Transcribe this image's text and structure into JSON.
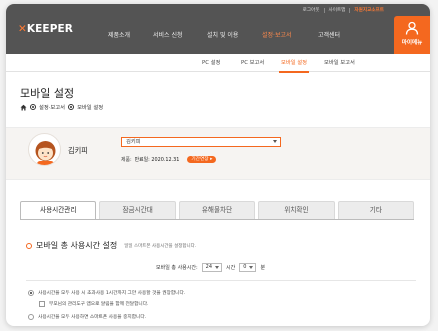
{
  "header": {
    "util_links": [
      "로그아웃",
      "사이트맵"
    ],
    "brand_link": "자원지교소프트",
    "logo_mark": "✕",
    "logo_text": "KEEPER",
    "nav": [
      "제품소개",
      "서비스 신청",
      "설치 및 이용",
      "설정·보고서",
      "고객센터"
    ],
    "active_nav": "설정·보고서",
    "my_menu_label": "마이메뉴",
    "accent_color": "#f4681f"
  },
  "subnav": {
    "items": [
      "PC 설정",
      "PC 보고서",
      "모바일 설정",
      "모바일 보고서"
    ],
    "active": "모바일 설정"
  },
  "page": {
    "title": "모바일 설정",
    "breadcrumb": [
      "설정·보고서",
      "모바일 설정"
    ]
  },
  "profile": {
    "name": "김키피",
    "selected_child": "김키피",
    "expiry_label": "제품:",
    "expiry_value": "만료일: 2020.12.31",
    "extend_button": "기간연장 ▸"
  },
  "tabs": {
    "items": [
      "사용시간관리",
      "잠금시간대",
      "유해물차단",
      "위치확인",
      "기타"
    ],
    "active": "사용시간관리"
  },
  "section": {
    "title": "모바일 총 사용시간 설정",
    "desc": "일일 스마트폰 사용시간을 설정합니다.",
    "total_label": "모바일 총 사용시간:",
    "hours_value": "24",
    "hours_unit": "시간",
    "minutes_value": "0",
    "minutes_unit": "분"
  },
  "options": {
    "opt1": "사용시간을 모두 사용 시 초과사용 1시간까지 그만 사용할 것을 권장합니다.",
    "opt1_sub": "부모님의 관리도구 앱으로 알림을 함께 전달합니다.",
    "opt2": "사용시간을 모두 사용하면 스마트폰 사용을 중지합니다."
  }
}
